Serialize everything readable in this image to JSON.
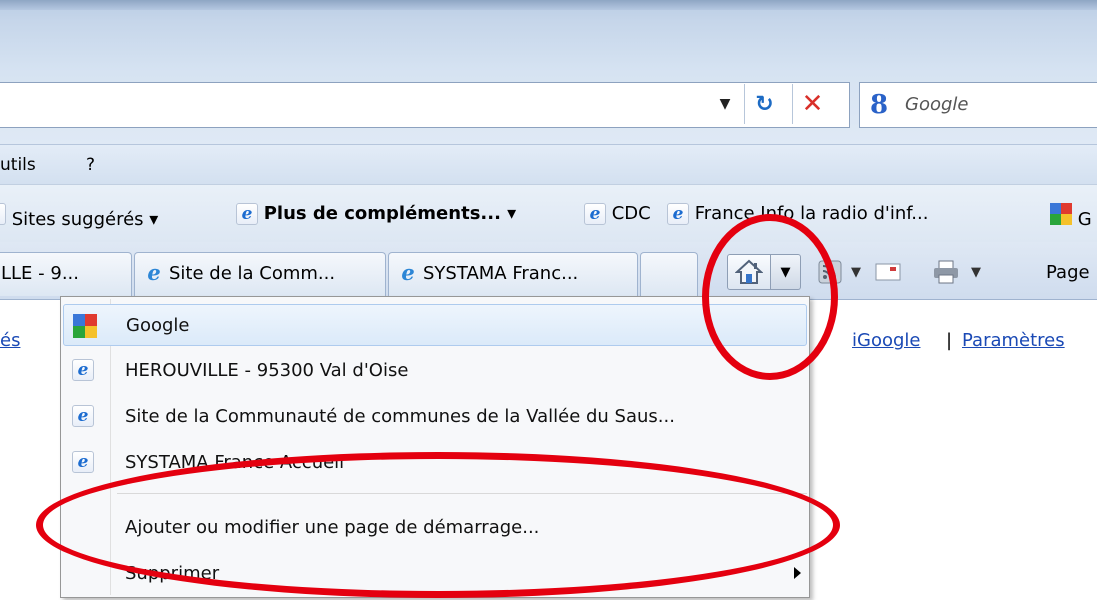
{
  "toolbar": {
    "search_placeholder": "Google",
    "search_logo": "8"
  },
  "menubar": {
    "items": [
      "utils",
      "?"
    ]
  },
  "favorites": {
    "items": [
      {
        "label": "Sites suggérés ▾",
        "icon": "ie-page-icon"
      },
      {
        "label": "Plus de compléments... ▾",
        "icon": "ie-page-icon",
        "bold": true
      },
      {
        "label": "CDC",
        "icon": "ie-page-icon"
      },
      {
        "label": "France Info  la radio d'inf...",
        "icon": "ie-page-icon"
      },
      {
        "label": "G",
        "icon": "google-icon"
      }
    ]
  },
  "tabs": [
    {
      "label": "LLE - 9..."
    },
    {
      "label": "Site de la Comm..."
    },
    {
      "label": "SYSTAMA Franc..."
    }
  ],
  "commandbar": {
    "page_label": "Page"
  },
  "page": {
    "left_link": "és",
    "igoogle_link": "iGoogle",
    "separator": "|",
    "params_link": "Paramètres"
  },
  "home_menu": {
    "items": [
      {
        "label": "Google",
        "icon": "google-icon"
      },
      {
        "label": "HEROUVILLE - 95300 Val d'Oise",
        "icon": "ie-page-icon"
      },
      {
        "label": "Site de la Communauté de communes de la Vallée du Saus...",
        "icon": "ie-page-icon"
      },
      {
        "label": "SYSTAMA France Accueil",
        "icon": "ie-page-icon"
      }
    ],
    "add_label": "Ajouter ou modifier une page de démarrage...",
    "remove_label": "Supprimer"
  },
  "colors": {
    "annotation": "#e4000f",
    "link": "#1a49b5",
    "chrome_blue": "#c6d6ea"
  }
}
